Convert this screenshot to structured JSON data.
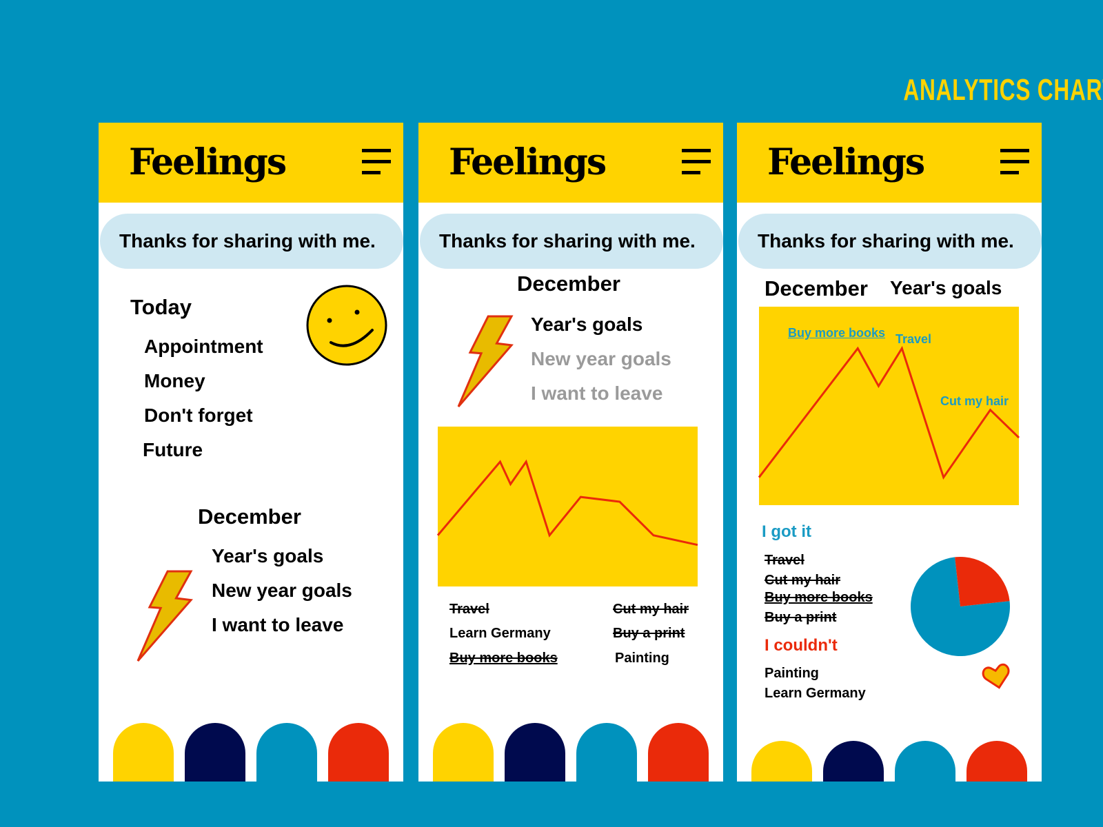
{
  "page_title": "ANALYTICS CHART",
  "colors": {
    "background": "#0092bd",
    "yellow": "#ffd300",
    "navy": "#000a4e",
    "blue": "#0092bd",
    "red": "#ea2a0a",
    "pill": "#cfe8f2",
    "label_blue": "#1a9bc4"
  },
  "app_name": "Feelings",
  "banner": "Thanks for sharing with me.",
  "icons": {
    "menu": "hamburger-icon",
    "smiley": "smiley-face-icon",
    "bolt": "lightning-bolt-icon",
    "heart": "heart-icon"
  },
  "bottom_tabs": [
    {
      "color": "yellow"
    },
    {
      "color": "navy"
    },
    {
      "color": "blue"
    },
    {
      "color": "red"
    }
  ],
  "panel1": {
    "today_heading": "Today",
    "today_items": [
      "Appointment",
      "Money",
      "Don't forget",
      "Future"
    ],
    "month_heading": "December",
    "month_items": [
      "Year's goals",
      "New year goals",
      "I want to leave"
    ]
  },
  "panel2": {
    "month_heading": "December",
    "month_items": [
      {
        "label": "Year's goals",
        "state": "active"
      },
      {
        "label": "New year goals",
        "state": "inactive"
      },
      {
        "label": "I want to leave",
        "state": "inactive"
      }
    ],
    "goals_left": [
      {
        "label": "Travel",
        "done": true
      },
      {
        "label": "Learn Germany",
        "done": false
      },
      {
        "label": "Buy more books",
        "done": true
      }
    ],
    "goals_right": [
      {
        "label": "Cut my hair",
        "done": true
      },
      {
        "label": "Buy a print",
        "done": true
      },
      {
        "label": "Painting",
        "done": false
      }
    ]
  },
  "panel3": {
    "month_heading": "December",
    "sub_heading": "Year's goals",
    "got_it_heading": "I got it",
    "got_it_items": [
      "Travel",
      "Cut my hair",
      "Buy more books",
      "Buy a print"
    ],
    "couldnt_heading": "I couldn't",
    "couldnt_items": [
      "Painting",
      "Learn Germany"
    ]
  },
  "chart_data": [
    {
      "type": "line",
      "title": "",
      "xlabel": "",
      "ylabel": "",
      "ylim": [
        0,
        100
      ],
      "grid": false,
      "points": [
        [
          0,
          32
        ],
        [
          24,
          78
        ],
        [
          28,
          64
        ],
        [
          34,
          78
        ],
        [
          43,
          32
        ],
        [
          55,
          56
        ],
        [
          70,
          53
        ],
        [
          83,
          32
        ],
        [
          100,
          26
        ]
      ]
    },
    {
      "type": "line",
      "title": "",
      "xlabel": "",
      "ylabel": "",
      "ylim": [
        0,
        100
      ],
      "grid": false,
      "points": [
        [
          0,
          14
        ],
        [
          38,
          79
        ],
        [
          46,
          60
        ],
        [
          55,
          79
        ],
        [
          71,
          14
        ],
        [
          89,
          48
        ],
        [
          100,
          34
        ]
      ],
      "annotations": [
        "Buy more books",
        "Travel",
        "Cut my hair"
      ]
    },
    {
      "type": "pie",
      "slices": [
        {
          "label": "I got it",
          "value": 75,
          "color": "#0092bd"
        },
        {
          "label": "I couldn't",
          "value": 25,
          "color": "#ea2a0a"
        }
      ]
    }
  ]
}
